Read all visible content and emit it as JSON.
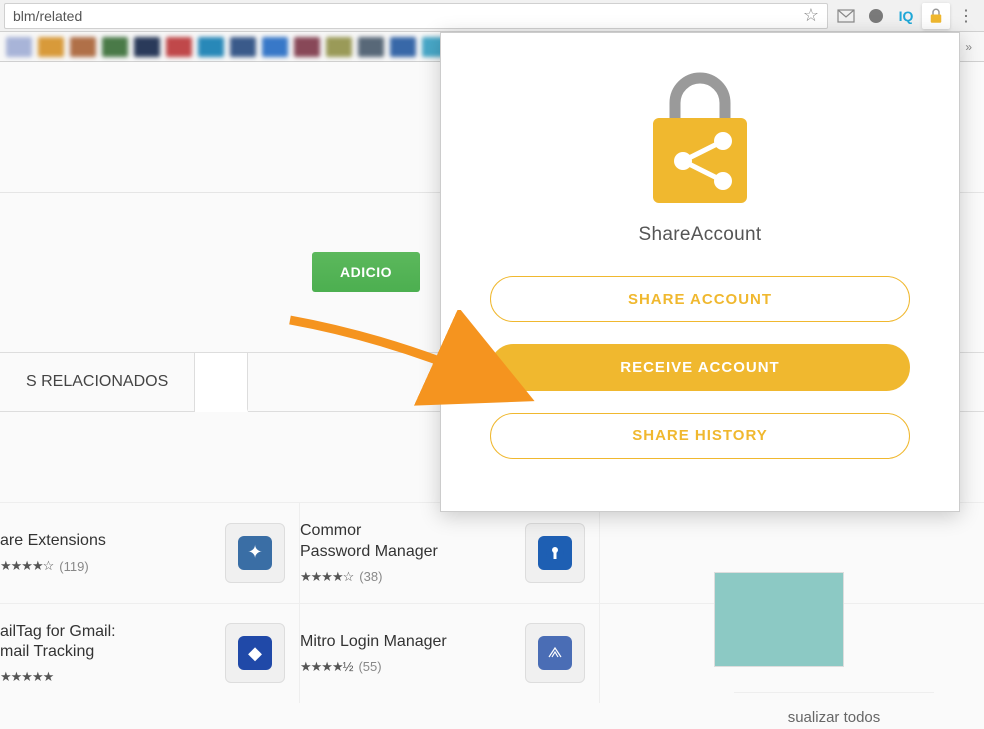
{
  "url": "blm/related",
  "toolbar": {
    "iq_label": "IQ"
  },
  "page": {
    "add_button": "ADICIO",
    "tab_related": "S RELACIONADOS",
    "view_all": "sualizar todos"
  },
  "extensions": [
    {
      "title": "are Extensions",
      "stars": "★★★★☆",
      "count": "(119)",
      "icon_bg": "#3a6ea5",
      "icon_glyph": "⚙"
    },
    {
      "title": "Commor\nPassword Manager",
      "stars": "★★★★☆",
      "count": "(38)",
      "icon_bg": "#1e5fb3",
      "icon_glyph": "●"
    },
    {
      "title": "ailTag for Gmail:\nmail Tracking",
      "stars": "★★★★★",
      "count": "",
      "icon_bg": "#2049a8",
      "icon_glyph": "◆"
    },
    {
      "title": "Mitro Login Manager",
      "stars": "★★★★½",
      "count": "(55)",
      "icon_bg": "#4a6db5",
      "icon_glyph": "▲"
    }
  ],
  "popup": {
    "title": "ShareAccount",
    "share_btn": "SHARE ACCOUNT",
    "receive_btn": "RECEIVE ACCOUNT",
    "history_btn": "SHARE HISTORY"
  },
  "bookmarks_colors": [
    "#a8b4d8",
    "#d89a3a",
    "#b07048",
    "#4a7a48",
    "#2a3a5a",
    "#c0484a",
    "#2888b8",
    "#3a5a8a",
    "#3878c8",
    "#884858",
    "#9a9a58",
    "#586878",
    "#3868a8",
    "#48a8c8",
    "#585858"
  ]
}
